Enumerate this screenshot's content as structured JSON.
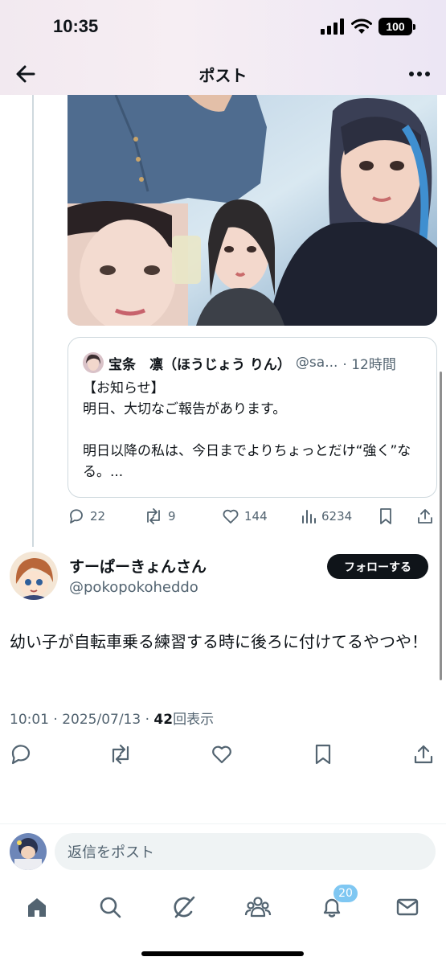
{
  "status_bar": {
    "time": "10:35",
    "battery": "100"
  },
  "header": {
    "title": "ポスト"
  },
  "quote": {
    "name": "宝条　凛（ほうじょう りん）",
    "handle": "@sa...",
    "time": "· 12時間",
    "text": "【お知らせ】\n明日、大切なご報告があります。\n\n明日以降の私は、今日までよりちょっとだけ“強く”なる。..."
  },
  "quote_actions": {
    "replies": "22",
    "reposts": "9",
    "likes": "144",
    "views": "6234"
  },
  "post": {
    "author_name": "すーぱーきょんさん",
    "author_handle": "@pokopokoheddo",
    "follow_label": "フォローする",
    "text": "幼い子が自転車乗る練習する時に後ろに付けてるやつや！",
    "timestamp": "10:01 · 2025/07/13 · ",
    "view_count": "42",
    "view_label": "回表示"
  },
  "reply": {
    "placeholder": "返信をポスト"
  },
  "nav": {
    "notifications_badge": "20"
  },
  "icons": [
    "back-arrow-icon",
    "more-icon",
    "reply-icon",
    "repost-icon",
    "like-icon",
    "views-icon",
    "bookmark-icon",
    "share-icon",
    "home-icon",
    "search-icon",
    "grok-icon",
    "communities-icon",
    "notifications-icon",
    "messages-icon"
  ],
  "colors": {
    "text": "#0f1419",
    "secondary": "#536471",
    "border": "#cfd9de",
    "badge": "#7fc7f2"
  }
}
